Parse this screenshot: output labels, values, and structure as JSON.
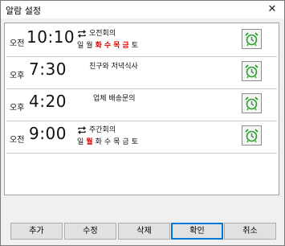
{
  "window": {
    "title": "알람 설정",
    "close_glyph": "✕"
  },
  "alarms": [
    {
      "ampm": "오전",
      "time": "10:10",
      "label": "오전회의",
      "repeat": true,
      "days": [
        {
          "t": "일",
          "on": false
        },
        {
          "t": "월",
          "on": false
        },
        {
          "t": "화",
          "on": true
        },
        {
          "t": "수",
          "on": true
        },
        {
          "t": "목",
          "on": true
        },
        {
          "t": "금",
          "on": true
        },
        {
          "t": "토",
          "on": false
        }
      ]
    },
    {
      "ampm": "오후",
      "time": "7:30",
      "label": "친구와 저녁식사",
      "repeat": false,
      "days": []
    },
    {
      "ampm": "오후",
      "time": "4:20",
      "label": "업체 배송문의",
      "repeat": false,
      "days": []
    },
    {
      "ampm": "오전",
      "time": "9:00",
      "label": "주간회의",
      "repeat": true,
      "days": [
        {
          "t": "일",
          "on": false
        },
        {
          "t": "월",
          "on": true
        },
        {
          "t": "화",
          "on": false
        },
        {
          "t": "수",
          "on": false
        },
        {
          "t": "목",
          "on": false
        },
        {
          "t": "금",
          "on": false
        },
        {
          "t": "토",
          "on": false
        }
      ]
    }
  ],
  "buttons": {
    "add": "추가",
    "edit": "수정",
    "delete": "삭제",
    "ok": "확인",
    "cancel": "취소"
  },
  "colors": {
    "active_day": "#e00000",
    "clock_icon": "#2e9e2e",
    "repeat_icon": "#1a1a1a"
  },
  "icons": {
    "repeat": "repeat-icon",
    "alarm": "alarm-clock-icon"
  }
}
